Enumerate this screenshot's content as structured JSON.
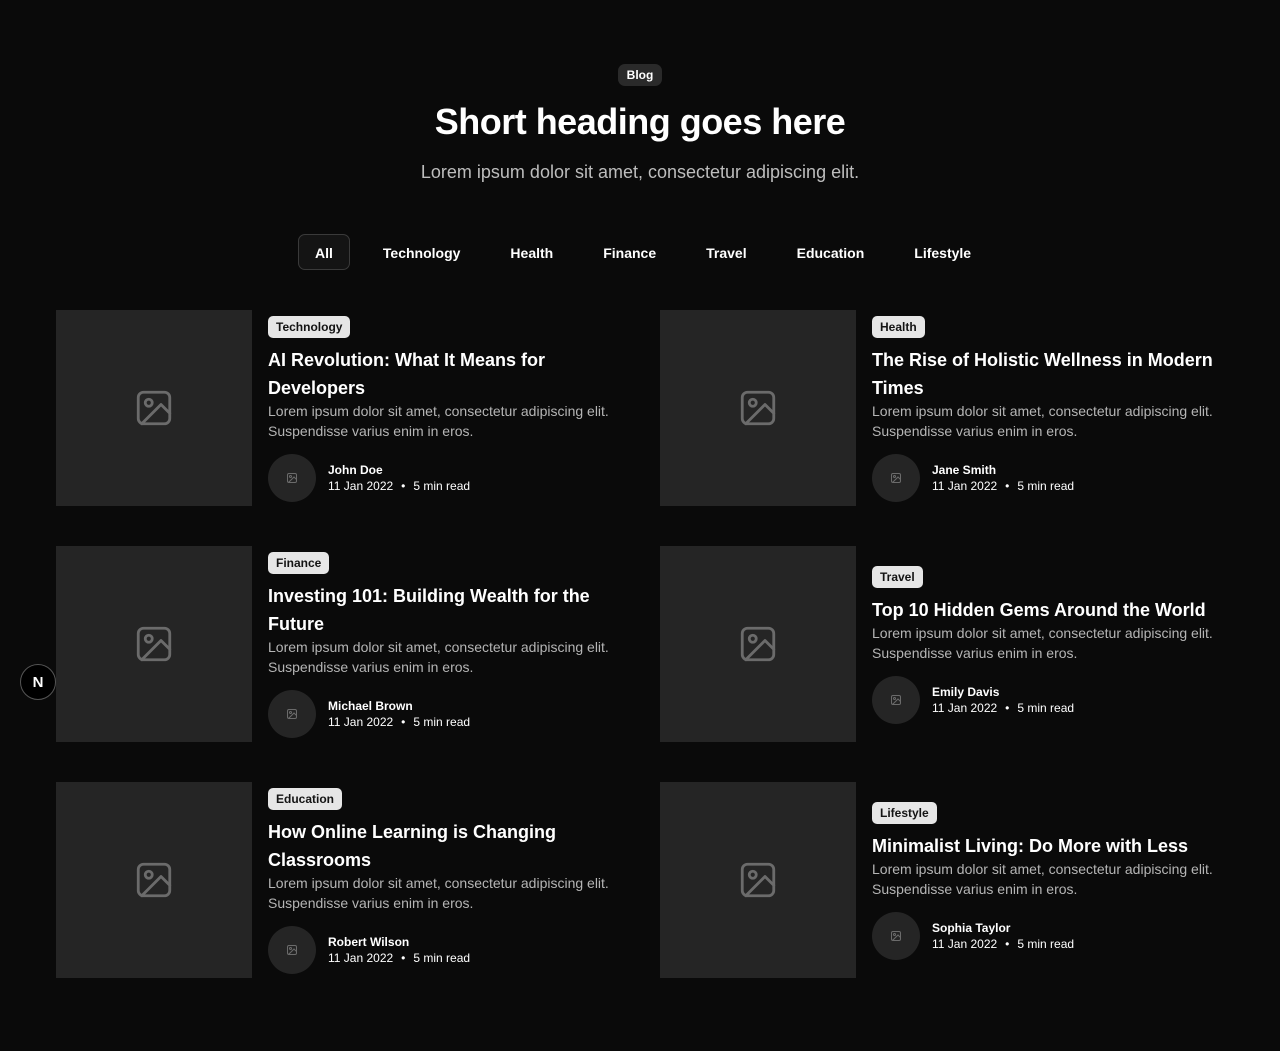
{
  "header": {
    "badge": "Blog",
    "title": "Short heading goes here",
    "subtitle": "Lorem ipsum dolor sit amet, consectetur adipiscing elit."
  },
  "tabs": [
    {
      "label": "All",
      "active": true
    },
    {
      "label": "Technology",
      "active": false
    },
    {
      "label": "Health",
      "active": false
    },
    {
      "label": "Finance",
      "active": false
    },
    {
      "label": "Travel",
      "active": false
    },
    {
      "label": "Education",
      "active": false
    },
    {
      "label": "Lifestyle",
      "active": false
    }
  ],
  "posts": [
    {
      "category": "Technology",
      "title": "AI Revolution: What It Means for Developers",
      "excerpt": "Lorem ipsum dolor sit amet, consectetur adipiscing elit. Suspendisse varius enim in eros.",
      "author": "John Doe",
      "date": "11 Jan 2022",
      "read_time": "5 min read"
    },
    {
      "category": "Health",
      "title": "The Rise of Holistic Wellness in Modern Times",
      "excerpt": "Lorem ipsum dolor sit amet, consectetur adipiscing elit. Suspendisse varius enim in eros.",
      "author": "Jane Smith",
      "date": "11 Jan 2022",
      "read_time": "5 min read"
    },
    {
      "category": "Finance",
      "title": "Investing 101: Building Wealth for the Future",
      "excerpt": "Lorem ipsum dolor sit amet, consectetur adipiscing elit. Suspendisse varius enim in eros.",
      "author": "Michael Brown",
      "date": "11 Jan 2022",
      "read_time": "5 min read"
    },
    {
      "category": "Travel",
      "title": "Top 10 Hidden Gems Around the World",
      "excerpt": "Lorem ipsum dolor sit amet, consectetur adipiscing elit. Suspendisse varius enim in eros.",
      "author": "Emily Davis",
      "date": "11 Jan 2022",
      "read_time": "5 min read"
    },
    {
      "category": "Education",
      "title": "How Online Learning is Changing Classrooms",
      "excerpt": "Lorem ipsum dolor sit amet, consectetur adipiscing elit. Suspendisse varius enim in eros.",
      "author": "Robert Wilson",
      "date": "11 Jan 2022",
      "read_time": "5 min read"
    },
    {
      "category": "Lifestyle",
      "title": "Minimalist Living: Do More with Less",
      "excerpt": "Lorem ipsum dolor sit amet, consectetur adipiscing elit. Suspendisse varius enim in eros.",
      "author": "Sophia Taylor",
      "date": "11 Jan 2022",
      "read_time": "5 min read"
    }
  ],
  "meta_separator": "•",
  "floating_button": {
    "label": "N"
  },
  "colors": {
    "background": "#0a0a0a",
    "placeholder": "#252525",
    "muted_text": "#b5b5b5",
    "category_badge": "#e6e6e6"
  },
  "icons": {
    "thumbnail": "image-placeholder-icon",
    "avatar": "image-placeholder-icon"
  }
}
